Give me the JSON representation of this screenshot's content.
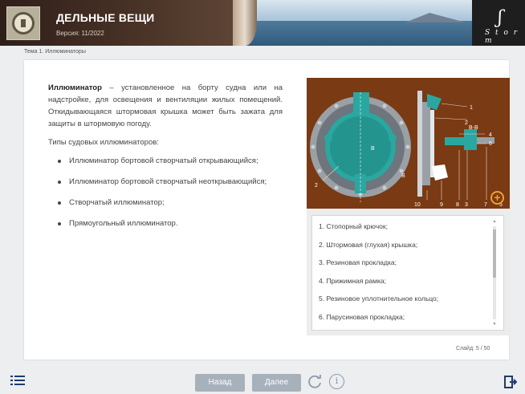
{
  "header": {
    "title": "ДЕЛЬНЫЕ ВЕЩИ",
    "version": "Версия: 11/2022",
    "brand_word": "S t o r m"
  },
  "breadcrumb": "Тема 1. Иллюминаторы",
  "content": {
    "term": "Иллюминатор",
    "definition": " – установленное на борту судна или на надстройке, для освещения и вентиляции жилых помещений. Откидывающаяся штормовая крышка может быть зажата для защиты в штормовую погоду.",
    "types_label": "Типы судовых иллюминаторов:",
    "types": [
      "Иллюминатор бортовой створчатый открывающийся;",
      "Иллюминатор бортовой створчатый неоткрывающийся;",
      "Створчатый иллюминатор;",
      "Прямоугольный иллюминатор."
    ]
  },
  "diagram": {
    "labels": [
      "1",
      "2",
      "В-В",
      "4",
      "6",
      "В",
      "В",
      "2",
      "10",
      "9",
      "8",
      "3",
      "7",
      "5"
    ]
  },
  "legend": {
    "items": [
      "1. Стопорный крючок;",
      "2. Штормовая (глухая) крышка;",
      "3. Резиновая прокладка;",
      "4. Прижимная рамка;",
      "5. Резиновое уплотнительное кольцо;",
      "6. Парусиновая прокладка;"
    ]
  },
  "slide_counter": "Слайд: 5 / 50",
  "footer": {
    "back_label": "Назад",
    "next_label": "Далее"
  },
  "colors": {
    "diagram_bg": "#7a3a13",
    "accent_teal": "#2aa7a0",
    "zoom": "#f0a030",
    "button": "#a7b1bc",
    "menu": "#1f3a6e"
  },
  "icons": [
    "menu-icon",
    "reload-icon",
    "info-icon",
    "exit-icon",
    "zoom-icon"
  ]
}
